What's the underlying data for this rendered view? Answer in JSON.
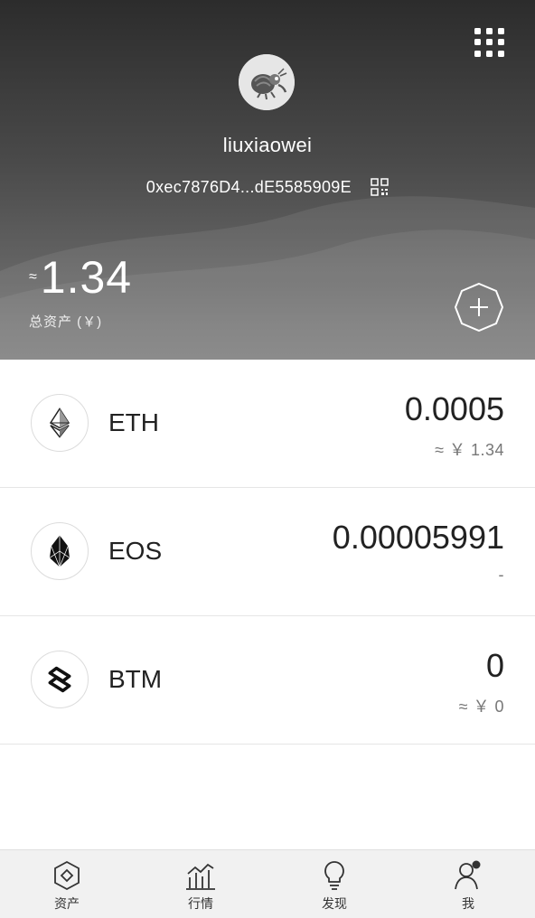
{
  "header": {
    "username": "liuxiaowei",
    "address": "0xec7876D4...dE5585909E",
    "balance_approx": "≈",
    "balance": "1.34",
    "total_label": "总资产 (￥)"
  },
  "assets": [
    {
      "symbol": "ETH",
      "icon": "ethereum-icon",
      "amount": "0.0005",
      "value": "≈ ￥ 1.34"
    },
    {
      "symbol": "EOS",
      "icon": "eos-icon",
      "amount": "0.00005991",
      "value": "-"
    },
    {
      "symbol": "BTM",
      "icon": "bytom-icon",
      "amount": "0",
      "value": "≈ ￥ 0"
    }
  ],
  "tabs": [
    {
      "label": "资产",
      "icon": "assets-icon"
    },
    {
      "label": "行情",
      "icon": "market-icon"
    },
    {
      "label": "发现",
      "icon": "discover-icon"
    },
    {
      "label": "我",
      "icon": "profile-icon"
    }
  ],
  "colors": {
    "header_top": "#2c2c2c",
    "header_bottom": "#7a7a7a",
    "tabbar_bg": "#f1f1f1"
  }
}
